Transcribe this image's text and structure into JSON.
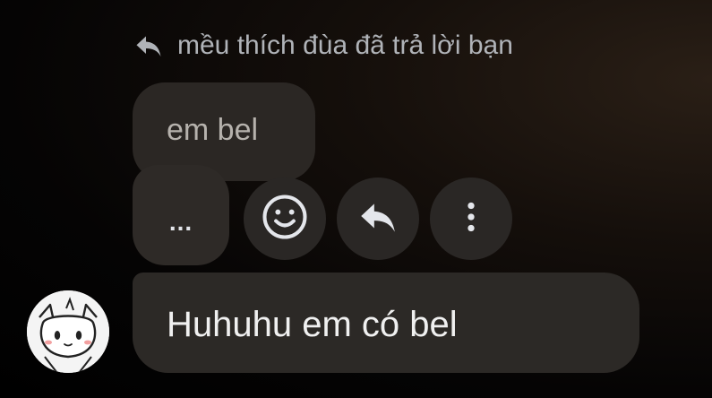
{
  "reply_header": {
    "icon": "reply-icon",
    "text": "mều thích đùa đã trả lời bạn"
  },
  "quoted_message": {
    "text": "em bel"
  },
  "collapsed_indicator": {
    "text": "..."
  },
  "actions": [
    {
      "name": "react-button",
      "icon": "smiley-icon"
    },
    {
      "name": "reply-button",
      "icon": "reply-icon"
    },
    {
      "name": "more-button",
      "icon": "vertical-dots-icon"
    }
  ],
  "message": {
    "text": "Huhuhu em có bel",
    "avatar_icon": "cartoon-cat-avatar"
  },
  "colors": {
    "bubble": "#2c2926",
    "action_button": "#2a2725",
    "header_text": "#b0b3b8",
    "message_text": "#f0f0f0"
  }
}
